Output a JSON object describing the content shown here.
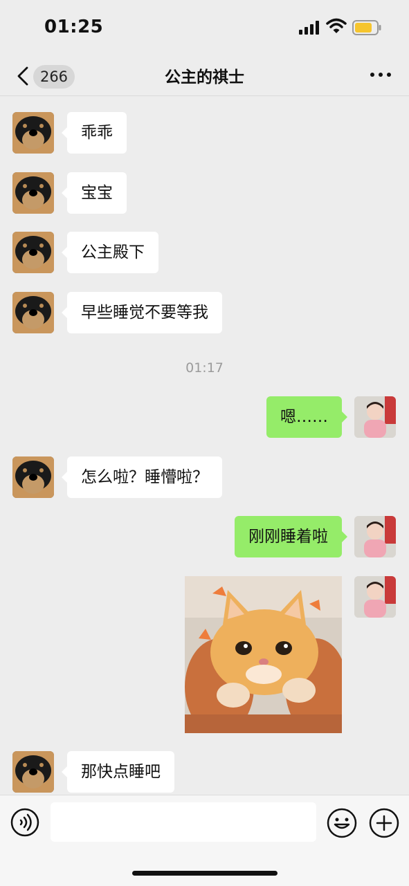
{
  "status_bar": {
    "time": "01:25",
    "battery_color": "#f6c52e"
  },
  "nav": {
    "unread_count": "266",
    "title": "公主的祺士"
  },
  "messages": [
    {
      "text": "乖乖"
    },
    {
      "text": "宝宝"
    },
    {
      "text": "公主殿下"
    },
    {
      "text": "早些睡觉不要等我"
    },
    {
      "timestamp": "01:17"
    },
    {
      "text": "嗯……"
    },
    {
      "text": "怎么啦？睡懵啦？"
    },
    {
      "text": "刚刚睡着啦"
    },
    {
      "image": "kitten-photo"
    },
    {
      "text": "那快点睡吧"
    }
  ],
  "colors": {
    "outgoing_bubble": "#95ec69",
    "incoming_bubble": "#ffffff",
    "background": "#ededed"
  },
  "input": {
    "value": "",
    "placeholder": ""
  }
}
